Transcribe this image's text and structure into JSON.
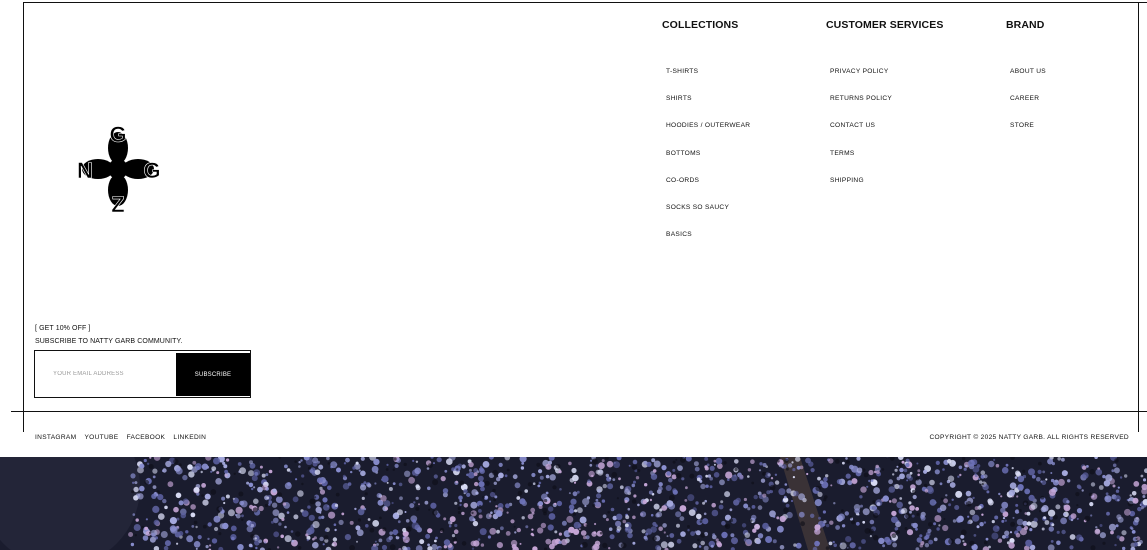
{
  "logo": {
    "letters": {
      "top": "G",
      "left": "N",
      "right": "G",
      "bottom": "Z"
    },
    "color": "#000000"
  },
  "footer": {
    "columns": [
      {
        "heading": "COLLECTIONS",
        "items": [
          "T-SHIRTS",
          "SHIRTS",
          "HOODIES / OUTERWEAR",
          "BOTTOMS",
          "CO-ORDS",
          "SOCKS SO SAUCY",
          "BASICS"
        ]
      },
      {
        "heading": "CUSTOMER SERVICES",
        "items": [
          "PRIVACY POLICY",
          "RETURNS POLICY",
          "CONTACT US",
          "TERMS",
          "SHIPPING"
        ]
      },
      {
        "heading": "BRAND",
        "items": [
          "ABOUT US",
          "CAREER",
          "STORE"
        ]
      }
    ],
    "subscribe": {
      "promo": "[ GET 10% OFF ]",
      "tagline": "SUBSCRIBE TO NATTY GARB COMMUNITY.",
      "email_placeholder": "YOUR EMAIL ADDRESS",
      "email_value": "",
      "button_label": "SUBSCRIBE"
    },
    "social": [
      "INSTAGRAM",
      "YOUTUBE",
      "FACEBOOK",
      "LINKEDIN"
    ],
    "copyright": "COPYRIGHT © 2025 NATTY GARB. ALL RIGHTS RESERVED"
  },
  "hero": {
    "icon": "flowering-tree-image",
    "colors": {
      "background": "#1a1c2e",
      "blossom": "#8a8fd0",
      "blossom_pink": "#c7a7d8",
      "trunk": "#3a3236"
    }
  }
}
